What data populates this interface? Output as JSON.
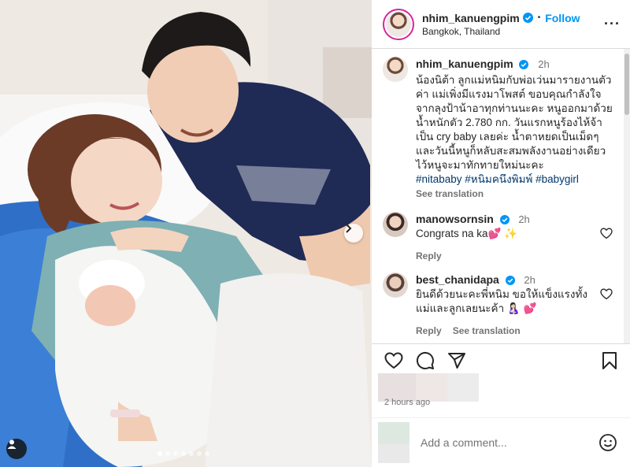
{
  "post": {
    "author": {
      "username": "nhim_kanuengpim",
      "location": "Bangkok, Thailand",
      "follow_label": "Follow",
      "bullet": "•",
      "more_label": "···"
    },
    "caption": {
      "username": "nhim_kanuengpim",
      "time": "2h",
      "text": "น้องนิต้า ลูกแม่หนิมกับพ่อเว่นมารายงานตัวค่า แม่เพิ่งมีแรงมาโพสต์ ขอบคุณกำลังใจจากลุงป้าน้าอาทุกท่านนะคะ หนูออกมาด้วยน้ำหนักตัว 2.780 กก. วันแรกหนูร้องไห้จ้าเป็น cry baby เลยค่ะ น้ำตาหยดเป็นเม็ดๆ และวันนี้หนูก็หลับสะสมพลังงานอย่างเดียว ไว้หนูจะมาทักทายใหม่นะคะ",
      "hashtags": "#nitababy #หนิมคนึงพิมพ์ #babygirl",
      "see_translation": "See translation"
    },
    "comments": [
      {
        "username": "manowsornsin",
        "time": "2h",
        "text": "Congrats na ka💕 ✨",
        "reply": "Reply",
        "see_translation": ""
      },
      {
        "username": "best_chanidapa",
        "time": "2h",
        "text": "ยินดีด้วยนะคะพี่หนิม ขอให้แข็งแรงทั้งแม่และลูกเลยนะค้า 🤱🏻 💕",
        "reply": "Reply",
        "see_translation": "See translation"
      }
    ],
    "timestamp": "2 hours ago",
    "add_comment_placeholder": "Add a comment...",
    "carousel": {
      "slide_count": 7,
      "active_index": 0
    }
  },
  "icons": {
    "like": "heart-icon",
    "comment": "comment-icon",
    "share": "share-icon",
    "save": "bookmark-icon",
    "emoji": "emoji-icon",
    "next": "chevron-right-icon",
    "tags": "user-tag-icon",
    "verified": "verified-badge-icon"
  },
  "colors": {
    "link_blue": "#0095f6",
    "hashtag": "#00376b",
    "verified": "#0095f6",
    "secondary_text": "#737373",
    "like_heart": "#ed4956"
  }
}
